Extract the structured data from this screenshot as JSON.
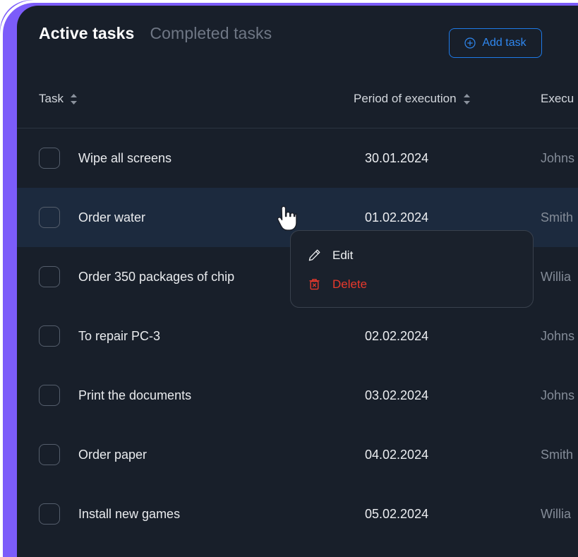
{
  "theme": {
    "frame_purple": "#7c5cfa",
    "card_background": "#181f2a",
    "row_highlight": "#1c2a3e",
    "accent_blue": "#2f87ef",
    "danger_red": "#e8392c",
    "muted_text": "#848c98"
  },
  "header": {
    "tabs": [
      {
        "label": "Active tasks",
        "active": true
      },
      {
        "label": "Completed tasks",
        "active": false
      }
    ],
    "add_task": {
      "label": "Add task",
      "icon": "plus-circle-icon"
    }
  },
  "table": {
    "columns": [
      {
        "key": "task",
        "label": "Task",
        "sort_icon": "sort-arrows-icon"
      },
      {
        "key": "period",
        "label": "Period of execution",
        "sort_icon": "sort-arrows-icon"
      },
      {
        "key": "executor",
        "label": "Execu",
        "sort_icon": "sort-arrows-icon"
      }
    ],
    "rows": [
      {
        "checked": false,
        "task": "Wipe all screens",
        "period": "30.01.2024",
        "executor": "Johns",
        "highlighted": false
      },
      {
        "checked": false,
        "task": "Order water",
        "period": "01.02.2024",
        "executor": "Smith",
        "highlighted": true
      },
      {
        "checked": false,
        "task": "Order 350 packages of chip",
        "period": "",
        "executor": "Willia",
        "highlighted": false
      },
      {
        "checked": false,
        "task": "To repair PC-3",
        "period": "02.02.2024",
        "executor": "Johns",
        "highlighted": false
      },
      {
        "checked": false,
        "task": "Print the documents",
        "period": "03.02.2024",
        "executor": "Johns",
        "highlighted": false
      },
      {
        "checked": false,
        "task": "Order paper",
        "period": "04.02.2024",
        "executor": "Smith",
        "highlighted": false
      },
      {
        "checked": false,
        "task": "Install new games",
        "period": "05.02.2024",
        "executor": "Willia",
        "highlighted": false
      }
    ]
  },
  "context_menu": {
    "items": [
      {
        "label": "Edit",
        "icon": "pencil-icon",
        "variant": "edit"
      },
      {
        "label": "Delete",
        "icon": "trash-x-icon",
        "variant": "delete"
      }
    ]
  },
  "cursor": {
    "icon": "pointing-hand-cursor"
  }
}
